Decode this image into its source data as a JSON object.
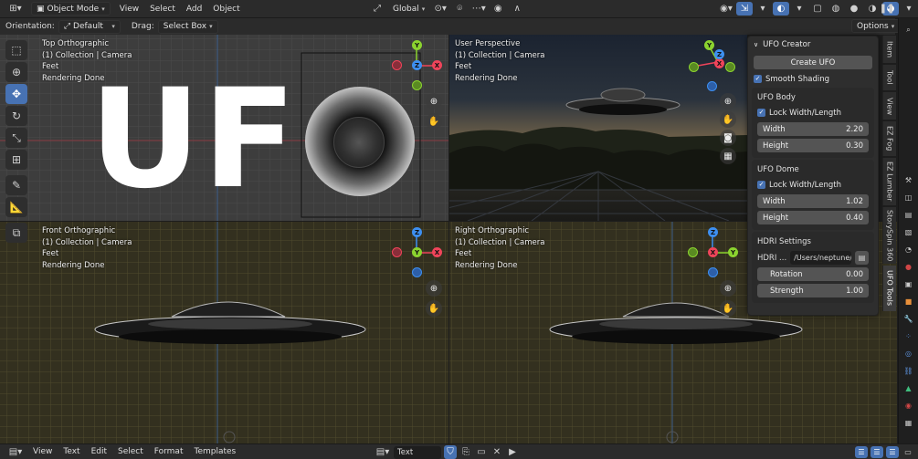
{
  "topbar": {
    "mode": "Object Mode",
    "menus": [
      "View",
      "Select",
      "Add",
      "Object"
    ],
    "transform_orientation": "Global"
  },
  "header": {
    "orientation_label": "Orientation:",
    "orientation_value": "Default",
    "drag_label": "Drag:",
    "drag_value": "Select Box",
    "options": "Options"
  },
  "viewports": {
    "top_left": {
      "title": "Top Orthographic",
      "collection": "(1) Collection | Camera",
      "units": "Feet",
      "status": "Rendering Done"
    },
    "top_right": {
      "title": "User Perspective",
      "collection": "(1) Collection | Camera",
      "units": "Feet",
      "status": "Rendering Done"
    },
    "bottom_left": {
      "title": "Front Orthographic",
      "collection": "(1) Collection | Camera",
      "units": "Feet",
      "status": "Rendering Done"
    },
    "bottom_right": {
      "title": "Right Orthographic",
      "collection": "(1) Collection | Camera",
      "units": "Feet",
      "status": "Rendering Done"
    }
  },
  "logo_text": "UF",
  "gizmo": {
    "x": "X",
    "y": "Y",
    "z": "Z"
  },
  "panel": {
    "title": "UFO Creator",
    "create_button": "Create UFO",
    "smooth_shading": "Smooth Shading",
    "body": {
      "title": "UFO Body",
      "lock": "Lock Width/Length",
      "width_label": "Width",
      "width_value": "2.20",
      "height_label": "Height",
      "height_value": "0.30"
    },
    "dome": {
      "title": "UFO Dome",
      "lock": "Lock Width/Length",
      "width_label": "Width",
      "width_value": "1.02",
      "height_label": "Height",
      "height_value": "0.40"
    },
    "hdri": {
      "title": "HDRI Settings",
      "label": "HDRI ...",
      "path": "/Users/neptune/D...",
      "rotation_label": "Rotation",
      "rotation_value": "0.00",
      "strength_label": "Strength",
      "strength_value": "1.00"
    }
  },
  "side_tabs": [
    "Item",
    "Tool",
    "View",
    "EZ Fog",
    "EZ Lumber",
    "StorySpin 360",
    "UFO Tools"
  ],
  "statusbar": {
    "menus": [
      "View",
      "Text",
      "Edit",
      "Select",
      "Format",
      "Templates"
    ],
    "text_block": "Text"
  },
  "colors": {
    "accent": "#4772b3",
    "x_axis": "#f0445a",
    "y_axis": "#8bd32f",
    "z_axis": "#3d8ff0"
  }
}
